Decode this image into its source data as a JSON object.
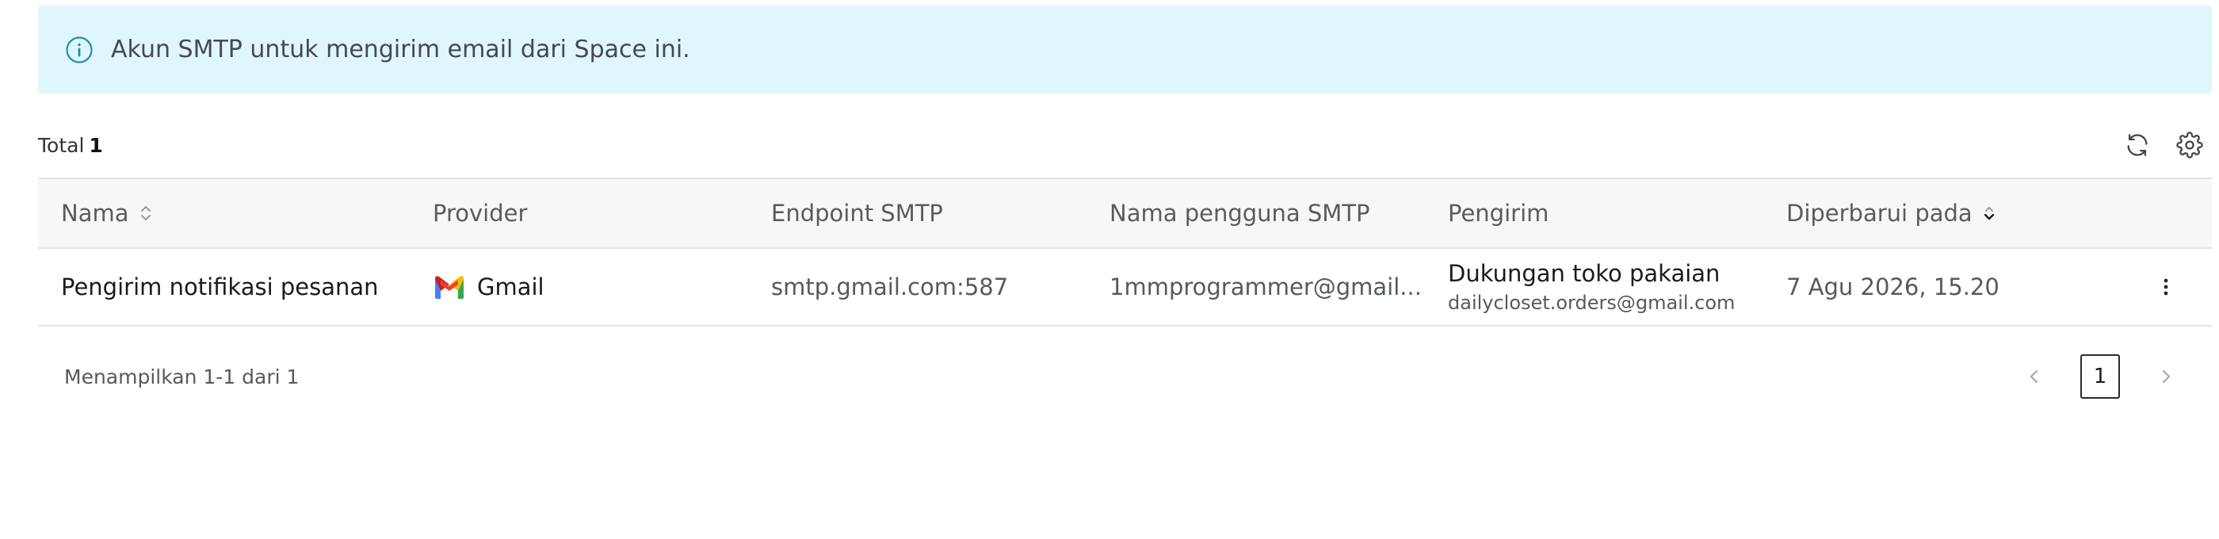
{
  "banner": {
    "icon": "info-icon",
    "text": "Akun SMTP untuk mengirim email dari Space ini."
  },
  "toolbar": {
    "total_label": "Total",
    "total_count": "1",
    "icons": [
      "refresh-icon",
      "gear-icon"
    ]
  },
  "table": {
    "headers": {
      "name": "Nama",
      "provider": "Provider",
      "endpoint": "Endpoint SMTP",
      "username": "Nama pengguna SMTP",
      "sender": "Pengirim",
      "updated": "Diperbarui pada"
    },
    "rows": [
      {
        "name": "Pengirim notifikasi pesanan",
        "provider": "Gmail",
        "provider_icon": "gmail-icon",
        "endpoint": "smtp.gmail.com:587",
        "username": "1mmprogrammer@gmail...",
        "sender_name": "Dukungan toko pakaian",
        "sender_email": "dailycloset.orders@gmail.com",
        "updated": "7 Agu 2026, 15.20"
      }
    ]
  },
  "footer": {
    "showing": "Menampilkan 1-1 dari 1",
    "current_page": "1"
  },
  "colors": {
    "banner_bg": "#dff7fc",
    "info_accent": "#1a8fb5",
    "gmail_red": "#ea4335",
    "gmail_blue": "#4285f4",
    "gmail_green": "#34a853",
    "gmail_yellow": "#fbbc04"
  }
}
